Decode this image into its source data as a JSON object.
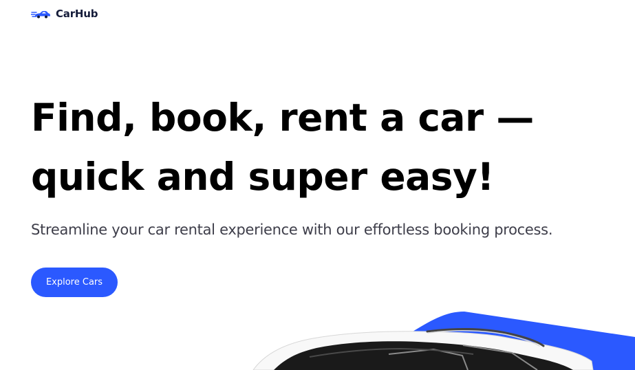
{
  "brand": {
    "name": "CarHub",
    "logo_icon": "car-logo-icon",
    "accent_color": "#2B59FF"
  },
  "hero": {
    "title": "Find, book, rent a car — quick and super easy!",
    "subtitle": "Streamline your car rental experience with our effortless booking process.",
    "cta_label": "Explore Cars",
    "visual": "car-with-blue-shape-image"
  }
}
